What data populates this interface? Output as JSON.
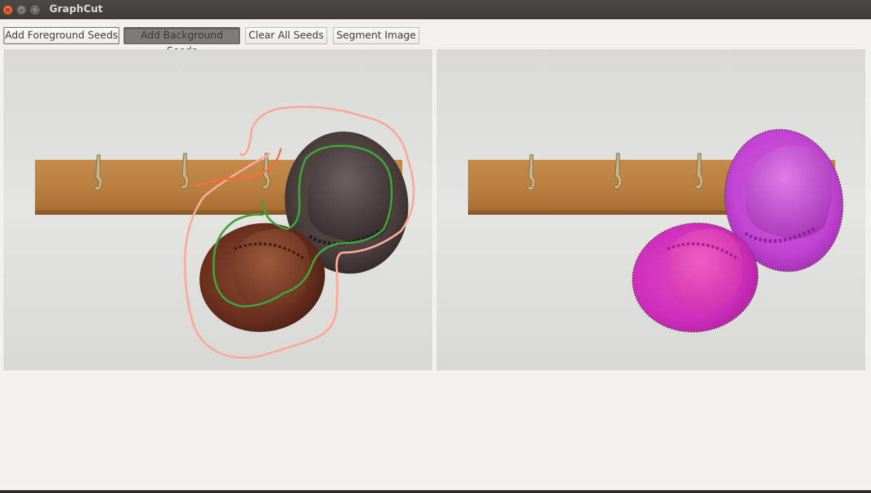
{
  "window": {
    "title": "GraphCut",
    "controls": [
      "close-icon",
      "minimize-icon",
      "maximize-icon"
    ]
  },
  "toolbar": {
    "buttons": [
      {
        "label": "Add Foreground Seeds",
        "active": false
      },
      {
        "label": "Add Background Seeds",
        "active": true
      },
      {
        "label": "Clear All Seeds",
        "active": false
      },
      {
        "label": "Segment Image",
        "active": false
      }
    ]
  },
  "panels": {
    "left": {
      "content": "input image with seed strokes"
    },
    "right": {
      "content": "segmentation result"
    }
  },
  "colors": {
    "foreground_seed": "#3ea33a",
    "background_seed": "#ffa89a",
    "background_seed_alt": "#ff6a3c",
    "segment_overlay": "#d62fd0",
    "titlebar": "#3c3b37",
    "window_bg": "#f2f1f0"
  }
}
